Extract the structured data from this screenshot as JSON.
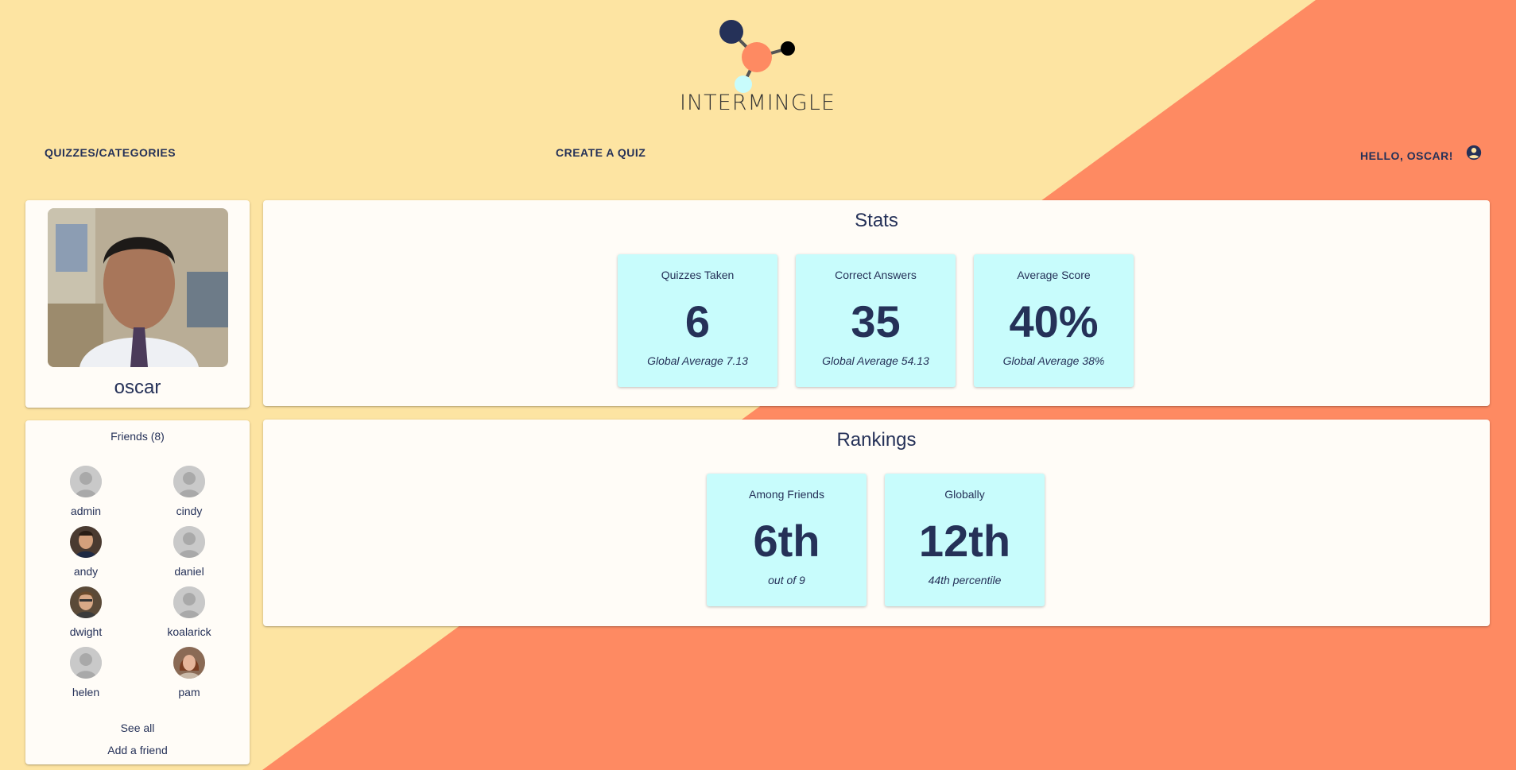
{
  "brand": {
    "logo_text": "INTERMINGLE"
  },
  "nav": {
    "quizzes_label": "QUIZZES/CATEGORIES",
    "create_label": "CREATE A QUIZ",
    "greeting": "HELLO, OSCAR!",
    "account_icon": "account-circle-icon"
  },
  "colors": {
    "background_cream": "#fde4a2",
    "background_coral": "#fe8a62",
    "tile_cyan": "#c8fcfc",
    "text_navy": "#253158"
  },
  "profile": {
    "username": "oscar"
  },
  "friends": {
    "title": "Friends (8)",
    "items": [
      {
        "name": "admin",
        "avatar": "default-avatar"
      },
      {
        "name": "cindy",
        "avatar": "default-avatar"
      },
      {
        "name": "andy",
        "avatar": "photo-avatar"
      },
      {
        "name": "daniel",
        "avatar": "default-avatar"
      },
      {
        "name": "dwight",
        "avatar": "photo-avatar"
      },
      {
        "name": "koalarick",
        "avatar": "default-avatar"
      },
      {
        "name": "helen",
        "avatar": "default-avatar"
      },
      {
        "name": "pam",
        "avatar": "photo-avatar"
      }
    ],
    "see_all_label": "See all",
    "add_label": "Add a friend"
  },
  "stats": {
    "title": "Stats",
    "tiles": [
      {
        "label": "Quizzes Taken",
        "value": "6",
        "sub": "Global Average 7.13"
      },
      {
        "label": "Correct Answers",
        "value": "35",
        "sub": "Global Average 54.13"
      },
      {
        "label": "Average Score",
        "value": "40%",
        "sub": "Global Average 38%"
      }
    ]
  },
  "rankings": {
    "title": "Rankings",
    "tiles": [
      {
        "label": "Among Friends",
        "value": "6th",
        "sub": "out of 9"
      },
      {
        "label": "Globally",
        "value": "12th",
        "sub": "44th percentile"
      }
    ]
  }
}
